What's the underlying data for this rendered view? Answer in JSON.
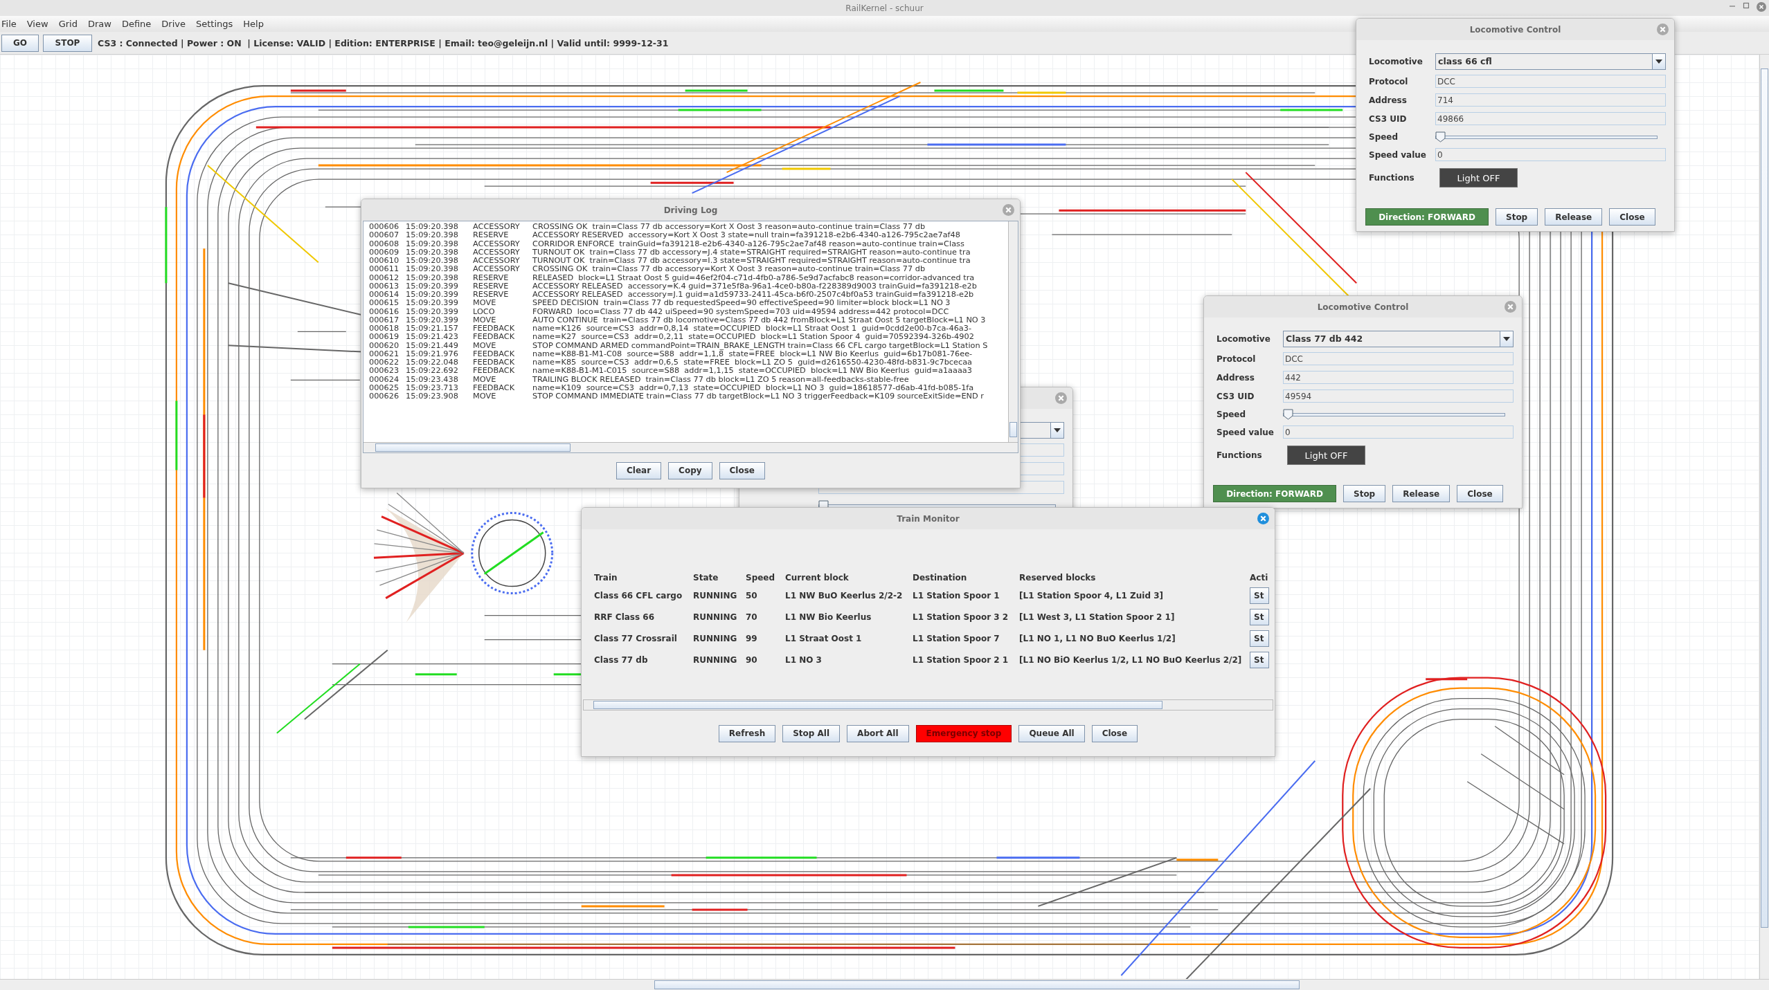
{
  "app": {
    "title": "RailKernel - schuur"
  },
  "menu": [
    "File",
    "View",
    "Grid",
    "Draw",
    "Define",
    "Drive",
    "Settings",
    "Help"
  ],
  "toolbar": {
    "buttons": [
      "GO",
      "STOP"
    ],
    "status": "CS3 : Connected | Power : ON  | License: VALID | Edition: ENTERPRISE | Email: teo@geleijn.nl | Valid until: 9999-12-31"
  },
  "background_loco_window": {
    "fields": [
      {
        "kind": "combo"
      },
      {
        "kind": "text"
      },
      {
        "kind": "text"
      },
      {
        "kind": "text"
      },
      {
        "kind": "slider",
        "level": 0
      }
    ]
  },
  "driving_log": {
    "title": "Driving Log",
    "entries": [
      {
        "seq": "000606",
        "time": "15:09:20.398",
        "category": "ACCESSORY",
        "message": "CROSSING OK  train=Class 77 db accessory=Kort X Oost 3 reason=auto-continue train=Class 77 db"
      },
      {
        "seq": "000607",
        "time": "15:09:20.398",
        "category": "RESERVE",
        "message": "ACCESSORY RESERVED  accessory=Kort X Oost 3 state=null train=fa391218-e2b6-4340-a126-795c2ae7af48"
      },
      {
        "seq": "000608",
        "time": "15:09:20.398",
        "category": "ACCESSORY",
        "message": "CORRIDOR ENFORCE  trainGuid=fa391218-e2b6-4340-a126-795c2ae7af48 reason=auto-continue train=Class"
      },
      {
        "seq": "000609",
        "time": "15:09:20.398",
        "category": "ACCESSORY",
        "message": "TURNOUT OK  train=Class 77 db accessory=J.4 state=STRAIGHT required=STRAIGHT reason=auto-continue tra"
      },
      {
        "seq": "000610",
        "time": "15:09:20.398",
        "category": "ACCESSORY",
        "message": "TURNOUT OK  train=Class 77 db accessory=I.3 state=STRAIGHT required=STRAIGHT reason=auto-continue tra"
      },
      {
        "seq": "000611",
        "time": "15:09:20.398",
        "category": "ACCESSORY",
        "message": "CROSSING OK  train=Class 77 db accessory=Kort X Oost 3 reason=auto-continue train=Class 77 db"
      },
      {
        "seq": "000612",
        "time": "15:09:20.398",
        "category": "RESERVE",
        "message": "RELEASED  block=L1 Straat Oost 5 guid=46ef2f04-c71d-4fb0-a786-5e9d7acfabc8 reason=corridor-advanced tra"
      },
      {
        "seq": "000613",
        "time": "15:09:20.399",
        "category": "RESERVE",
        "message": "ACCESSORY RELEASED  accessory=K.4 guid=371e5f8a-96a1-4ce0-b80a-f228389d9003 trainGuid=fa391218-e2b"
      },
      {
        "seq": "000614",
        "time": "15:09:20.399",
        "category": "RESERVE",
        "message": "ACCESSORY RELEASED  accessory=J.1 guid=a1d59733-2411-45ca-b6f0-2507c4bf0a53 trainGuid=fa391218-e2b"
      },
      {
        "seq": "000615",
        "time": "15:09:20.399",
        "category": "MOVE",
        "message": "SPEED DECISION  train=Class 77 db requestedSpeed=90 effectiveSpeed=90 limiter=block block=L1 NO 3"
      },
      {
        "seq": "000616",
        "time": "15:09:20.399",
        "category": "LOCO",
        "message": "FORWARD  loco=Class 77 db 442 uiSpeed=90 systemSpeed=703 uid=49594 address=442 protocol=DCC"
      },
      {
        "seq": "000617",
        "time": "15:09:20.399",
        "category": "MOVE",
        "message": "AUTO CONTINUE  train=Class 77 db locomotive=Class 77 db 442 fromBlock=L1 Straat Oost 5 targetBlock=L1 NO 3"
      },
      {
        "seq": "000618",
        "time": "15:09:21.157",
        "category": "FEEDBACK",
        "message": "name=K126  source=CS3  addr=0,8,14  state=OCCUPIED  block=L1 Straat Oost 1  guid=0cdd2e00-b7ca-46a3-"
      },
      {
        "seq": "000619",
        "time": "15:09:21.423",
        "category": "FEEDBACK",
        "message": "name=K27  source=CS3  addr=0,2,11  state=OCCUPIED  block=L1 Station Spoor 4  guid=70592394-326b-4902"
      },
      {
        "seq": "000620",
        "time": "15:09:21.449",
        "category": "MOVE",
        "message": "STOP COMMAND ARMED commandPoint=TRAIN_BRAKE_LENGTH train=Class 66 CFL cargo targetBlock=L1 Station S"
      },
      {
        "seq": "000621",
        "time": "15:09:21.976",
        "category": "FEEDBACK",
        "message": "name=K88-B1-M1-C08  source=S88  addr=1,1,8  state=FREE  block=L1 NW Bio Keerlus  guid=6b17b081-76ee-"
      },
      {
        "seq": "000622",
        "time": "15:09:22.048",
        "category": "FEEDBACK",
        "message": "name=K85  source=CS3  addr=0,6,5  state=FREE  block=L1 ZO 5  guid=d2616550-4230-48fd-b831-9c7bcecaa"
      },
      {
        "seq": "000623",
        "time": "15:09:22.692",
        "category": "FEEDBACK",
        "message": "name=K88-B1-M1-C015  source=S88  addr=1,1,15  state=OCCUPIED  block=L1 NW Bio Keerlus  guid=a1aaaa3"
      },
      {
        "seq": "000624",
        "time": "15:09:23.438",
        "category": "MOVE",
        "message": "TRAILING BLOCK RELEASED  train=Class 77 db block=L1 ZO 5 reason=all-feedbacks-stable-free"
      },
      {
        "seq": "000625",
        "time": "15:09:23.713",
        "category": "FEEDBACK",
        "message": "name=K109  source=CS3  addr=0,7,13  state=OCCUPIED  block=L1 NO 3  guid=18618577-d6ab-41fd-b085-1fa"
      },
      {
        "seq": "000626",
        "time": "15:09:23.908",
        "category": "MOVE",
        "message": "STOP COMMAND IMMEDIATE train=Class 77 db targetBlock=L1 NO 3 triggerFeedback=K109 sourceExitSide=END r"
      }
    ],
    "buttons": [
      "Clear",
      "Copy",
      "Close"
    ]
  },
  "loco_windows": [
    {
      "title": "Locomotive Control",
      "fields": [
        {
          "label": "Locomotive",
          "kind": "combo",
          "value": "class 66 cfl"
        },
        {
          "label": "Protocol",
          "kind": "text",
          "value": "DCC"
        },
        {
          "label": "Address",
          "kind": "text",
          "value": "714"
        },
        {
          "label": "CS3 UID",
          "kind": "text",
          "value": "49866"
        },
        {
          "label": "Speed",
          "kind": "slider",
          "level": 0
        },
        {
          "label": "Speed value",
          "kind": "text",
          "value": "0"
        },
        {
          "label": "Functions",
          "kind": "function",
          "value": "Light OFF"
        }
      ],
      "buttons": [
        {
          "label": "Direction: FORWARD",
          "kind": "direction"
        },
        {
          "label": "Stop",
          "kind": "plain"
        },
        {
          "label": "Release",
          "kind": "plain"
        },
        {
          "label": "Close",
          "kind": "plain"
        }
      ]
    },
    {
      "title": "Locomotive Control",
      "fields": [
        {
          "label": "Locomotive",
          "kind": "combo",
          "value": "Class 77 db 442"
        },
        {
          "label": "Protocol",
          "kind": "text",
          "value": "DCC"
        },
        {
          "label": "Address",
          "kind": "text",
          "value": "442"
        },
        {
          "label": "CS3 UID",
          "kind": "text",
          "value": "49594"
        },
        {
          "label": "Speed",
          "kind": "slider",
          "level": 0
        },
        {
          "label": "Speed value",
          "kind": "text",
          "value": "0"
        },
        {
          "label": "Functions",
          "kind": "function",
          "value": "Light OFF"
        }
      ],
      "buttons": [
        {
          "label": "Direction: FORWARD",
          "kind": "direction"
        },
        {
          "label": "Stop",
          "kind": "plain"
        },
        {
          "label": "Release",
          "kind": "plain"
        },
        {
          "label": "Close",
          "kind": "plain"
        }
      ]
    }
  ],
  "train_monitor": {
    "title": "Train Monitor",
    "columns": [
      "Train",
      "State",
      "Speed",
      "Current block",
      "Destination",
      "Reserved blocks",
      "Acti"
    ],
    "rows": [
      {
        "train": "Class 66 CFL cargo",
        "state": "RUNNING",
        "speed": "50",
        "current_block": "L1 NW BuO Keerlus 2/2-2",
        "destination": "L1 Station Spoor 1",
        "reserved": "[L1 Station Spoor 4, L1 Zuid 3]",
        "action": "St"
      },
      {
        "train": "RRF Class 66",
        "state": "RUNNING",
        "speed": "70",
        "current_block": "L1 NW Bio Keerlus",
        "destination": "L1 Station Spoor 3 2",
        "reserved": "[L1 West 3, L1 Station Spoor 2 1]",
        "action": "St"
      },
      {
        "train": "Class 77 Crossrail",
        "state": "RUNNING",
        "speed": "99",
        "current_block": "L1 Straat Oost 1",
        "destination": "L1 Station Spoor 7",
        "reserved": "[L1 NO 1, L1 NO BuO Keerlus 1/2]",
        "action": "St"
      },
      {
        "train": "Class 77 db",
        "state": "RUNNING",
        "speed": "90",
        "current_block": "L1 NO 3",
        "destination": "L1 Station Spoor 2 1",
        "reserved": "[L1 NO BiO Keerlus 1/2, L1 NO BuO Keerlus 2/2]",
        "action": "St"
      }
    ],
    "buttons": [
      {
        "label": "Refresh",
        "kind": "plain"
      },
      {
        "label": "Stop All",
        "kind": "plain"
      },
      {
        "label": "Abort All",
        "kind": "plain"
      },
      {
        "label": "Emergency stop",
        "kind": "emergency"
      },
      {
        "label": "Queue All",
        "kind": "plain"
      },
      {
        "label": "Close",
        "kind": "plain"
      }
    ]
  }
}
